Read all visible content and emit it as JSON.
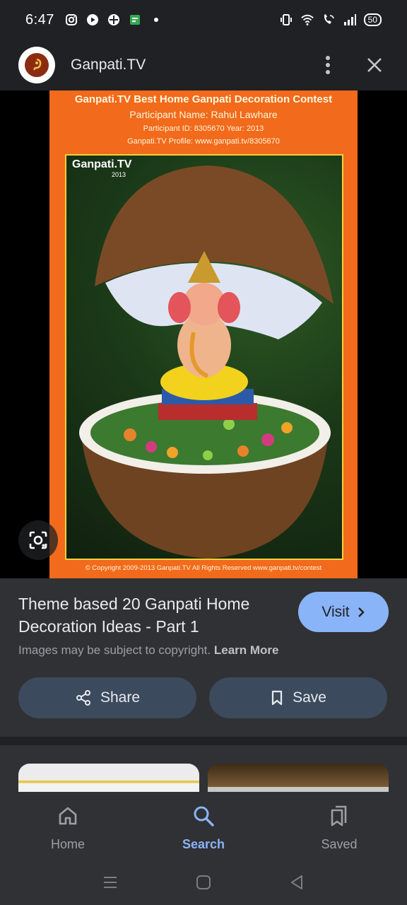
{
  "status_bar": {
    "time": "6:47",
    "left_icons": [
      "instagram-icon",
      "youtube-icon",
      "app-icon",
      "gallery-icon",
      "dot-icon"
    ],
    "right_icons": [
      "vibrate-icon",
      "wifi-icon",
      "wifi-calling-icon",
      "signal-icon"
    ],
    "battery": "50"
  },
  "header": {
    "site_name": "Ganpati.TV"
  },
  "poster": {
    "title": "Ganpati.TV Best Home Ganpati Decoration Contest",
    "participant_name": "Participant Name: Rahul Lawhare",
    "participant_id": "Participant ID: 8305670   Year: 2013",
    "profile": "Ganpati.TV Profile: www.ganpati.tv/8305670",
    "watermark": "Ganpati.TV",
    "watermark_year": "2013",
    "copyright": "© Copyright 2009-2013 Ganpati.TV All Rights Reserved   www.ganpati.tv/contest"
  },
  "result": {
    "title": "Theme based 20 Ganpati Home Decoration Ideas - Part 1",
    "visit_label": "Visit",
    "copyright_note": "Images may be subject to copyright.",
    "learn_more": "Learn More",
    "share_label": "Share",
    "save_label": "Save"
  },
  "bottom_nav": {
    "items": [
      {
        "label": "Home",
        "icon": "home-icon",
        "active": false
      },
      {
        "label": "Search",
        "icon": "search-icon",
        "active": true
      },
      {
        "label": "Saved",
        "icon": "saved-icon",
        "active": false
      }
    ]
  },
  "colors": {
    "background": "#202124",
    "surface": "#303134",
    "accent": "#8ab4f8",
    "button": "#3c4a5e",
    "poster_orange": "#f26a1b"
  }
}
